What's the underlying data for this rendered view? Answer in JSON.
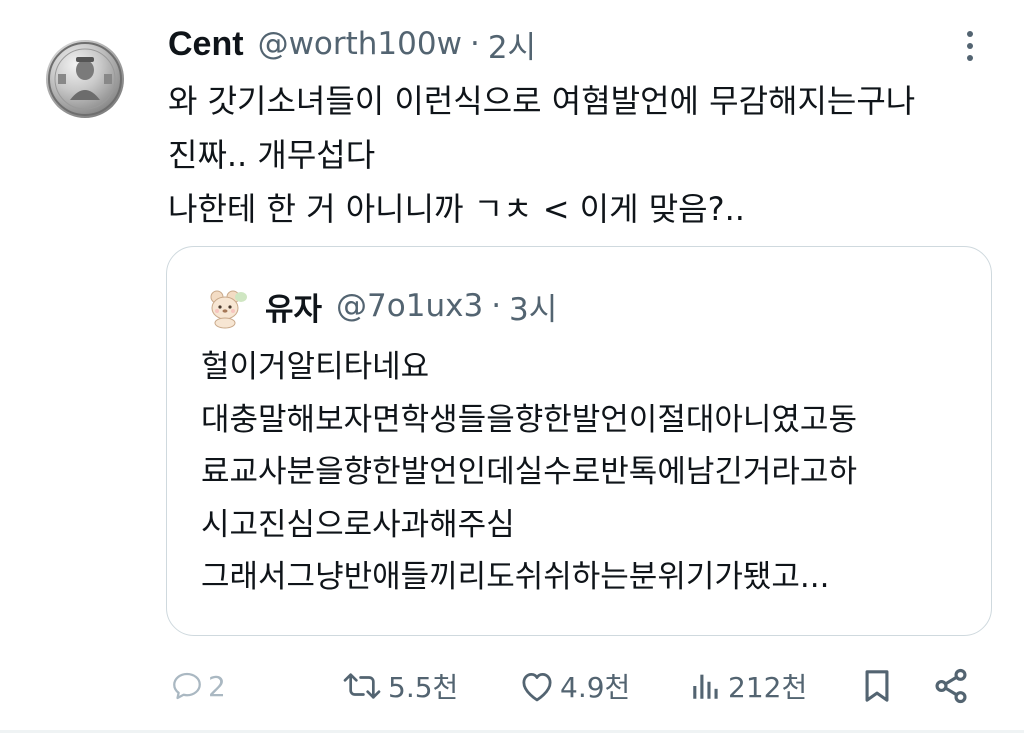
{
  "tweet": {
    "author": {
      "display_name": "Cent",
      "handle": "@worth100w",
      "separator": "·",
      "time": "2시",
      "avatar_icon": "coin-avatar"
    },
    "lines": [
      "와 갓기소녀들이 이런식으로 여혐발언에 무감해지는구나",
      "진짜.. 개무섭다",
      "나한테 한 거 아니니까 ㄱㅊ < 이게 맞음?.."
    ]
  },
  "quote": {
    "author": {
      "display_name": "유자",
      "handle": "@7o1ux3",
      "separator": "·",
      "time": "3시",
      "avatar_icon": "bear-avatar"
    },
    "lines": [
      "헐이거알티타네요",
      "대충말해보자면학생들을향한발언이절대아니였고동",
      "료교사분을향한발언인데실수로반톡에남긴거라고하",
      "시고진심으로사과해주심",
      "그래서그냥반애들끼리도쉬쉬하는분위기가됐고..."
    ]
  },
  "actions": {
    "reply": {
      "count": "2",
      "icon": "reply-icon"
    },
    "retweet": {
      "count": "5.5천",
      "icon": "retweet-icon"
    },
    "like": {
      "count": "4.9천",
      "icon": "heart-icon"
    },
    "views": {
      "count": "212천",
      "icon": "views-icon"
    },
    "bookmark": {
      "icon": "bookmark-icon"
    },
    "share": {
      "icon": "share-icon"
    }
  },
  "colors": {
    "text": "#0f1419",
    "secondary": "#536471",
    "border": "#cfd9de"
  }
}
